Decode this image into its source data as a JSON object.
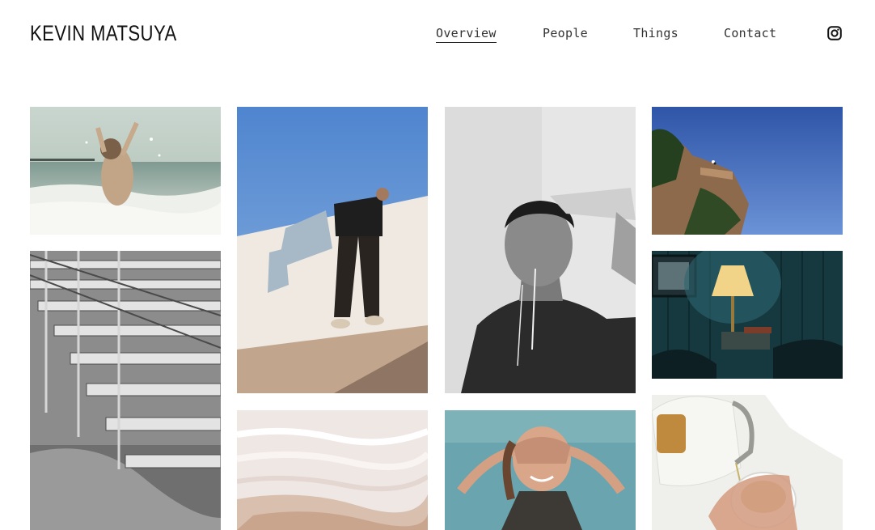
{
  "site": {
    "title": "KEVIN MATSUYA"
  },
  "nav": {
    "items": [
      {
        "label": "Overview",
        "active": true
      },
      {
        "label": "People",
        "active": false
      },
      {
        "label": "Things",
        "active": false
      },
      {
        "label": "Contact",
        "active": false
      }
    ],
    "social_icon": "instagram-icon"
  },
  "gallery": {
    "photos": [
      {
        "name": "photo-beach-wave",
        "subject": "beach-wave"
      },
      {
        "name": "photo-bleachers",
        "subject": "bleachers"
      },
      {
        "name": "photo-wall-climbers",
        "subject": "wall-climbers"
      },
      {
        "name": "photo-travertine-terraces",
        "subject": "travertine-terraces"
      },
      {
        "name": "photo-water-bottle-portrait",
        "subject": "water-bottle-portrait"
      },
      {
        "name": "photo-hands-over-eyes",
        "subject": "hands-over-eyes"
      },
      {
        "name": "photo-cliff-sky",
        "subject": "cliff-sky"
      },
      {
        "name": "photo-bedside-lamp",
        "subject": "bedside-lamp"
      },
      {
        "name": "photo-teapot-pour",
        "subject": "teapot-pour"
      }
    ]
  }
}
